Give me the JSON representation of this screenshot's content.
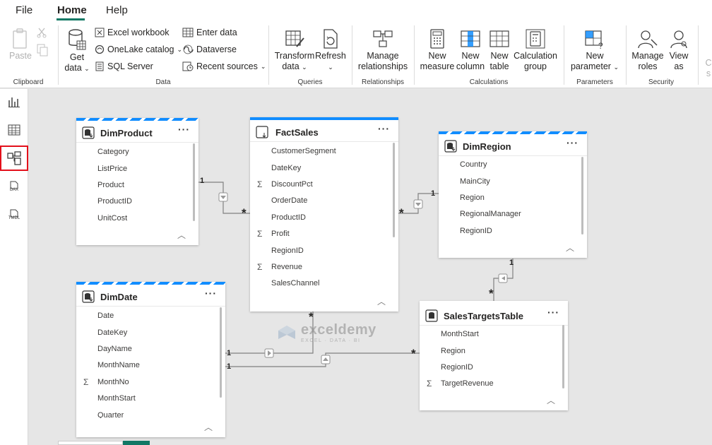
{
  "menu": {
    "file": "File",
    "home": "Home",
    "help": "Help"
  },
  "ribbon": {
    "clipboard": {
      "paste": "Paste",
      "group": "Clipboard"
    },
    "data": {
      "get_data": "Get",
      "get_data2": "data",
      "excel": "Excel workbook",
      "onelake": "OneLake catalog",
      "sql": "SQL Server",
      "enter_data": "Enter data",
      "dataverse": "Dataverse",
      "recent": "Recent sources",
      "group": "Data"
    },
    "queries": {
      "transform": "Transform",
      "transform2": "data",
      "refresh": "Refresh",
      "group": "Queries"
    },
    "relationships": {
      "manage": "Manage",
      "manage2": "relationships",
      "group": "Relationships"
    },
    "calculations": {
      "new_measure": "New",
      "new_measure2": "measure",
      "new_column": "New",
      "new_column2": "column",
      "new_table": "New",
      "new_table2": "table",
      "calc_group": "Calculation",
      "calc_group2": "group",
      "group": "Calculations"
    },
    "parameters": {
      "new_param": "New",
      "new_param2": "parameter",
      "group": "Parameters"
    },
    "security": {
      "manage_roles": "Manage",
      "manage_roles2": "roles",
      "view_as": "View",
      "view_as2": "as",
      "group": "Security"
    },
    "cut_off": "C",
    "cut_off2": "s"
  },
  "rail": {
    "dax": "DAX",
    "tmdl": "TMDL"
  },
  "tables": {
    "dimproduct": {
      "name": "DimProduct",
      "fields": [
        "Category",
        "ListPrice",
        "Product",
        "ProductID",
        "UnitCost"
      ]
    },
    "factsales": {
      "name": "FactSales",
      "fields": [
        "CustomerSegment",
        "DateKey",
        "DiscountPct",
        "OrderDate",
        "ProductID",
        "Profit",
        "RegionID",
        "Revenue",
        "SalesChannel"
      ]
    },
    "dimregion": {
      "name": "DimRegion",
      "fields": [
        "Country",
        "MainCity",
        "Region",
        "RegionalManager",
        "RegionID"
      ]
    },
    "dimdate": {
      "name": "DimDate",
      "fields": [
        "Date",
        "DateKey",
        "DayName",
        "MonthName",
        "MonthNo",
        "MonthStart",
        "Quarter"
      ]
    },
    "salestargets": {
      "name": "SalesTargetsTable",
      "fields": [
        "MonthStart",
        "Region",
        "RegionID",
        "TargetRevenue"
      ]
    }
  },
  "relations": {
    "one": "1",
    "many": "*"
  },
  "watermark": {
    "title": "exceldemy",
    "sub": "EXCEL · DATA · BI"
  },
  "colors": {
    "accent": "#118dff",
    "active_outline": "#e3101b",
    "brand_green": "#117865"
  }
}
